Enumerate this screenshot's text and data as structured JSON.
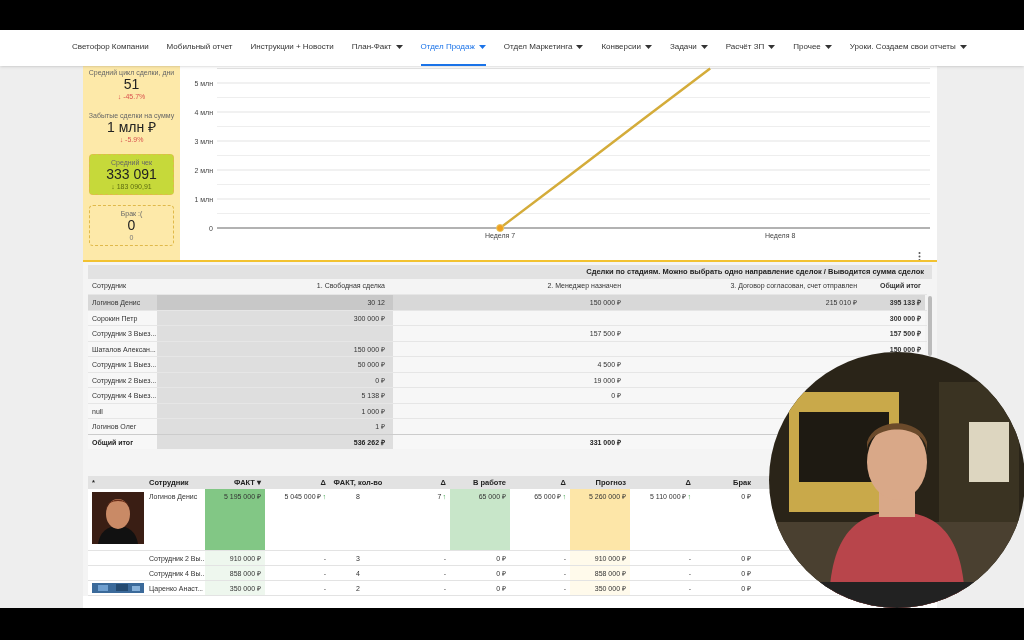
{
  "nav": [
    {
      "label": "Светофор Компании",
      "dropdown": false,
      "selected": false
    },
    {
      "label": "Мобильный отчет",
      "dropdown": false,
      "selected": false
    },
    {
      "label": "Инструкции + Новости",
      "dropdown": false,
      "selected": false
    },
    {
      "label": "План-Факт",
      "dropdown": true,
      "selected": false
    },
    {
      "label": "Отдел Продаж",
      "dropdown": true,
      "selected": true
    },
    {
      "label": "Отдел Маркетинга",
      "dropdown": true,
      "selected": false
    },
    {
      "label": "Конверсии",
      "dropdown": true,
      "selected": false
    },
    {
      "label": "Задачи",
      "dropdown": true,
      "selected": false
    },
    {
      "label": "Расчёт ЗП",
      "dropdown": true,
      "selected": false
    },
    {
      "label": "Прочее",
      "dropdown": true,
      "selected": false
    },
    {
      "label": "Уроки. Создаем свои отчеты",
      "dropdown": true,
      "selected": false
    }
  ],
  "kpis": [
    {
      "kind": "plain",
      "label": "Средний цикл сделки, дни",
      "value": "51",
      "delta": "↓ -45.7%"
    },
    {
      "kind": "plain",
      "label": "Забытые сделки на сумму",
      "value": "1 млн ₽",
      "delta": "↓ -5.9%"
    },
    {
      "kind": "filled",
      "label": "Средний чек",
      "value": "333 091",
      "delta": "↓ 183 090,91"
    },
    {
      "kind": "dashed",
      "label": "Брак :(",
      "value": "0",
      "delta": "0"
    }
  ],
  "chart": {
    "chart_data": {
      "type": "line",
      "grid": true,
      "categories": [
        null,
        null,
        null,
        null,
        "Неделя 7",
        null,
        null,
        null,
        "Неделя 8",
        null,
        null
      ],
      "ylim": [
        0,
        5.5
      ],
      "yticks": [
        {
          "value": 0,
          "label": "0"
        },
        {
          "value": 1,
          "label": "1 млн"
        },
        {
          "value": 2,
          "label": "2 млн"
        },
        {
          "value": 3,
          "label": "3 млн"
        },
        {
          "value": 4,
          "label": "4 млн"
        },
        {
          "value": 5,
          "label": "5 млн"
        }
      ],
      "series": [
        {
          "color": "#d4ac3a",
          "values": [
            null,
            null,
            null,
            null,
            0,
            1.83,
            3.67,
            5.5,
            null,
            null,
            null
          ]
        }
      ]
    }
  },
  "pivot": {
    "title": "Сделки по стадиям. Можно выбрать одно направление сделок / Выводится сумма сделок",
    "columns": [
      "Сотрудник",
      "1. Свободная сделка",
      "2. Менеджер назначен",
      "3. Договор согласован, счет отправлен",
      "Общий итог"
    ],
    "rows": [
      {
        "cells": [
          "Логинов Денис",
          "30 12",
          "150 000 ₽",
          "215 010 ₽",
          "395 133 ₽"
        ],
        "selected": true
      },
      {
        "cells": [
          "Сорокин Петр",
          "300 000 ₽",
          null,
          null,
          "300 000 ₽"
        ],
        "selected": false
      },
      {
        "cells": [
          "Сотрудник 3 Выез...",
          null,
          "157 500 ₽",
          null,
          "157 500 ₽"
        ],
        "selected": false
      },
      {
        "cells": [
          "Шаталов Алексан...",
          "150 000 ₽",
          null,
          null,
          "150 000 ₽"
        ],
        "selected": false
      },
      {
        "cells": [
          "Сотрудник 1 Выез...",
          "50 000 ₽",
          "4 500 ₽"
        ],
        "selected": false
      },
      {
        "cells": [
          "Сотрудник 2 Выез...",
          "0 ₽",
          "19 000 ₽"
        ],
        "selected": false
      },
      {
        "cells": [
          "Сотрудник 4 Выез...",
          "5 138 ₽",
          "0 ₽"
        ],
        "selected": false
      },
      {
        "cells": [
          "null",
          "1 000 ₽"
        ],
        "selected": false
      },
      {
        "cells": [
          "Логинов Олег",
          "1 ₽"
        ],
        "selected": false
      }
    ],
    "total": [
      "Общий итог",
      "536 262 ₽",
      "331 000 ₽"
    ]
  },
  "table": {
    "columns": [
      "*",
      "Сотрудник",
      "ФАКТ ▾",
      "Δ",
      "ФАКТ, кол-во",
      "Δ",
      "В работе",
      "Δ",
      "Прогноз",
      "Δ",
      "Брак"
    ],
    "rows": [
      {
        "highlighted": true,
        "cells": [
          {
            "kind": "picture"
          },
          "Логинов Денис",
          "5 195 000 ₽",
          {
            "text": "5 045 000 ₽",
            "trend": "↑"
          },
          "8",
          {
            "text": "7",
            "trend": "↑"
          },
          "65 000 ₽",
          {
            "text": "65 000 ₽",
            "trend": "↑"
          },
          "5 260 000 ₽",
          {
            "text": "5 110 000 ₽",
            "trend": "↑"
          },
          "0 ₽"
        ]
      },
      {
        "highlighted": false,
        "cells": [
          null,
          "Сотрудник 2 Вы...",
          "910 000 ₽",
          "-",
          "3",
          "-",
          "0 ₽",
          "-",
          "910 000 ₽",
          "-",
          "0 ₽"
        ]
      },
      {
        "highlighted": false,
        "cells": [
          null,
          "Сотрудник 4 Вы...",
          "858 000 ₽",
          "-",
          "4",
          "-",
          "0 ₽",
          "-",
          "858 000 ₽",
          "-",
          "0 ₽"
        ]
      },
      {
        "highlighted": false,
        "cells": [
          {
            "kind": "picture"
          },
          "Царенко Анаст...",
          "350 000 ₽",
          "-",
          "2",
          "-",
          "0 ₽",
          "-",
          "350 000 ₽",
          "-",
          "0 ₽"
        ]
      }
    ]
  },
  "webcam": {
    "kind": "picture"
  }
}
